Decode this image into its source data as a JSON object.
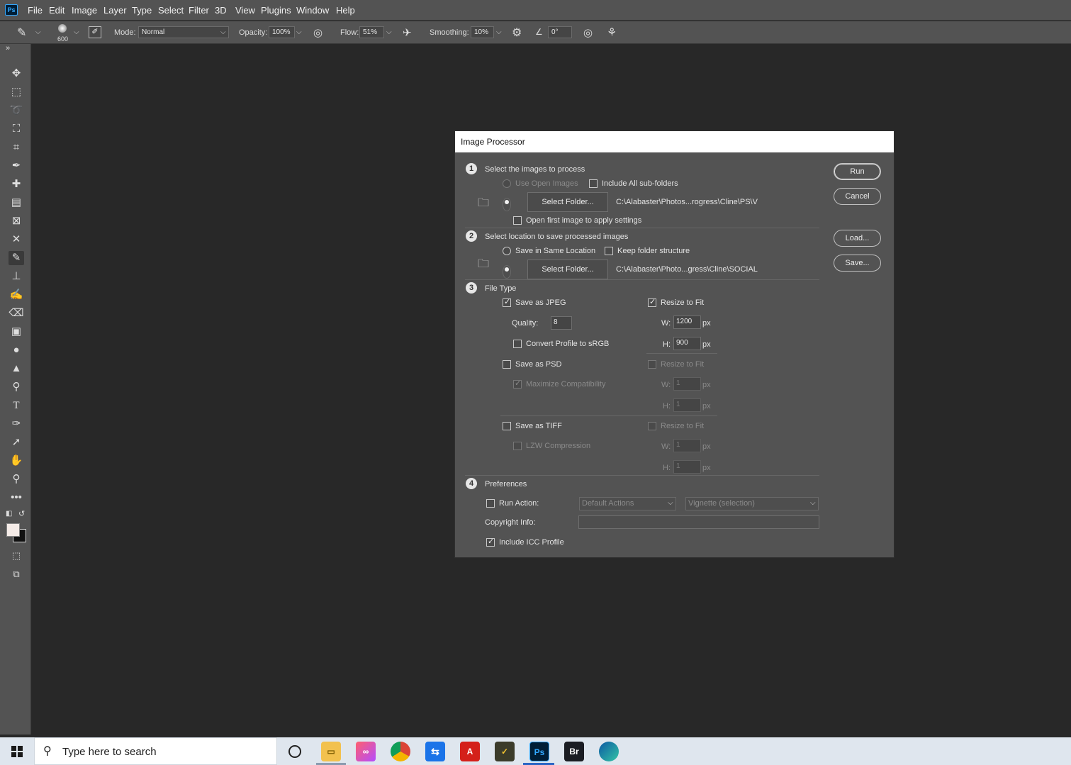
{
  "menubar": {
    "logo": "Ps",
    "items": [
      "File",
      "Edit",
      "Image",
      "Layer",
      "Type",
      "Select",
      "Filter",
      "3D",
      "View",
      "Plugins",
      "Window",
      "Help"
    ]
  },
  "options": {
    "brush_size": "600",
    "mode_label": "Mode:",
    "mode_value": "Normal",
    "opacity_label": "Opacity:",
    "opacity_value": "100%",
    "flow_label": "Flow:",
    "flow_value": "51%",
    "smoothing_label": "Smoothing:",
    "smoothing_value": "10%",
    "angle_value": "0°"
  },
  "toolbar": {
    "expand": "»",
    "tools": [
      "move-icon",
      "marquee-icon",
      "lasso-icon",
      "object-select-icon",
      "crop-icon",
      "eyedropper-icon",
      "healing-brush-icon",
      "patch-icon",
      "frame-icon",
      "content-aware-move-icon",
      "brush-icon",
      "clone-stamp-icon",
      "history-brush-icon",
      "eraser-icon",
      "gradient-icon",
      "blur-icon",
      "sharpen-icon",
      "dodge-icon",
      "type-icon",
      "pen-icon",
      "path-select-icon",
      "hand-icon",
      "zoom-icon",
      "more-tools-icon"
    ],
    "active_tool": "brush-icon",
    "foreground_color": "#f5ece8",
    "background_color": "#111111"
  },
  "dialog": {
    "title": "Image Processor",
    "s1": {
      "num": "1",
      "heading": "Select the images to process",
      "use_open": "Use Open Images",
      "include_sub": "Include All sub-folders",
      "select_folder": "Select Folder...",
      "path": "C:\\Alabaster\\Photos...rogress\\Cline\\PS\\V",
      "open_first": "Open first image to apply settings"
    },
    "s2": {
      "num": "2",
      "heading": "Select location to save processed images",
      "same_location": "Save in Same Location",
      "keep_structure": "Keep folder structure",
      "select_folder": "Select Folder...",
      "path": "C:\\Alabaster\\Photo...gress\\Cline\\SOCIAL"
    },
    "s3": {
      "num": "3",
      "heading": "File Type",
      "jpeg": "Save as JPEG",
      "resize": "Resize to Fit",
      "quality_label": "Quality:",
      "quality": "8",
      "w_label": "W:",
      "h_label": "H:",
      "px": "px",
      "jpeg_w": "1200",
      "jpeg_h": "900",
      "convert": "Convert Profile to sRGB",
      "psd": "Save as PSD",
      "maximize": "Maximize Compatibility",
      "psd_w": "1",
      "psd_h": "1",
      "tiff": "Save as TIFF",
      "lzw": "LZW Compression",
      "tiff_w": "1",
      "tiff_h": "1"
    },
    "s4": {
      "num": "4",
      "heading": "Preferences",
      "run_action": "Run Action:",
      "action_set": "Default Actions",
      "action": "Vignette (selection)",
      "copyright": "Copyright Info:",
      "copyright_value": "",
      "icc": "Include ICC Profile"
    },
    "buttons": {
      "run": "Run",
      "cancel": "Cancel",
      "load": "Load...",
      "save": "Save..."
    }
  },
  "taskbar": {
    "search_placeholder": "Type here to search",
    "apps": [
      "task-view-icon",
      "file-explorer-icon",
      "creative-cloud-icon",
      "chrome-icon",
      "teamviewer-icon",
      "acrobat-icon",
      "tasks-icon",
      "photoshop-icon",
      "bridge-icon",
      "edge-icon"
    ],
    "ps_label": "Ps",
    "br_label": "Br"
  }
}
